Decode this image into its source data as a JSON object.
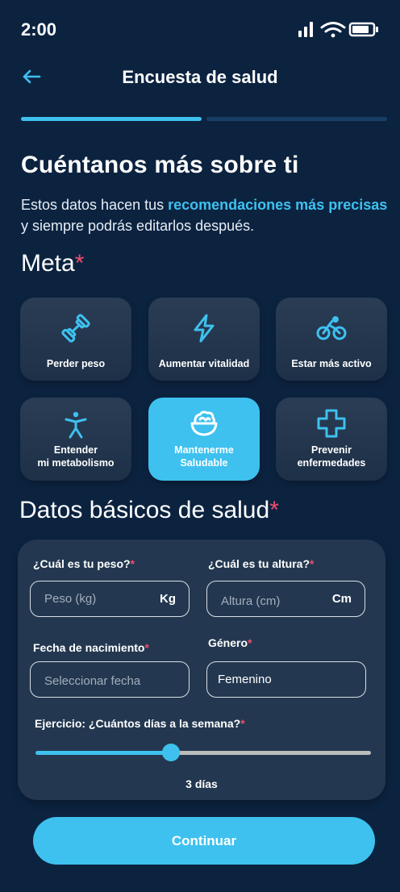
{
  "status_bar": {
    "time": "2:00"
  },
  "header": {
    "title": "Encuesta de salud"
  },
  "progress": {
    "current_step": 1,
    "total_steps": 2
  },
  "intro": {
    "heading": "Cuéntanos más sobre ti",
    "text_before": "Estos datos hacen tus ",
    "text_highlight": "recomendaciones más precisas",
    "text_after": " y siempre podrás editarlos después."
  },
  "goal_section": {
    "title": "Meta",
    "required_mark": "*",
    "options": [
      {
        "icon": "dumbbell-icon",
        "line1": "Perder peso",
        "line2": "",
        "selected": false
      },
      {
        "icon": "lightning-icon",
        "line1": "Aumentar vitalidad",
        "line2": "",
        "selected": false
      },
      {
        "icon": "bicycle-icon",
        "line1": "Estar más activo",
        "line2": "",
        "selected": false
      },
      {
        "icon": "accessibility-person-icon",
        "line1": "Entender",
        "line2": "mi metabolismo",
        "selected": false
      },
      {
        "icon": "salad-bowl-icon",
        "line1": "Mantenerme",
        "line2": "Saludable",
        "selected": true
      },
      {
        "icon": "medical-cross-icon",
        "line1": "Prevenir",
        "line2": "enfermedades",
        "selected": false
      }
    ]
  },
  "health_section": {
    "title": "Datos básicos de salud",
    "required_mark": "*",
    "weight": {
      "label": "¿Cuál es tu peso?",
      "placeholder": "Peso (kg)",
      "unit": "Kg"
    },
    "height": {
      "label": "¿Cuál es tu altura?",
      "placeholder": "Altura (cm)",
      "unit": "Cm"
    },
    "birthdate": {
      "label": "Fecha de nacimiento",
      "placeholder": "Seleccionar fecha"
    },
    "gender": {
      "label": "Género",
      "value": "Femenino"
    },
    "exercise": {
      "label": "Ejercicio: ¿Cuántos días a la semana?",
      "value_label": "3 días",
      "days": 3,
      "max_days": 7
    }
  },
  "actions": {
    "continue_label": "Continuar"
  },
  "colors": {
    "background": "#0c2340",
    "accent": "#3ec1ef",
    "required": "#ef4d6b",
    "card": "#233850"
  }
}
